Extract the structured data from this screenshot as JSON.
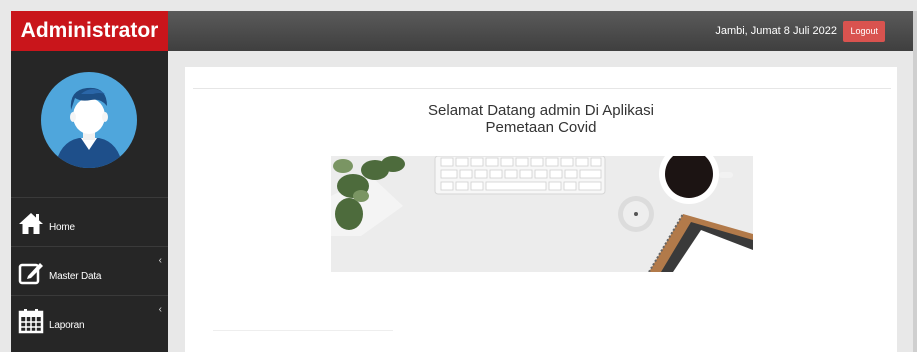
{
  "brand": {
    "title": "Administrator"
  },
  "topbar": {
    "date": "Jambi, Jumat 8 Juli 2022",
    "logout_label": "Logout"
  },
  "sidebar": {
    "items": [
      {
        "label": "Home",
        "icon": "home-icon",
        "has_submenu": false
      },
      {
        "label": "Master Data",
        "icon": "edit-icon",
        "has_submenu": true
      },
      {
        "label": "Laporan",
        "icon": "calendar-icon",
        "has_submenu": true
      }
    ],
    "chevron": "‹"
  },
  "main": {
    "welcome_line1": "Selamat Datang admin Di Aplikasi",
    "welcome_line2": "Pemetaan Covid"
  },
  "colors": {
    "brand_red": "#c9151b",
    "sidebar_bg": "#262626",
    "logout_red": "#d9534f",
    "avatar_blue": "#4fa6dc"
  }
}
